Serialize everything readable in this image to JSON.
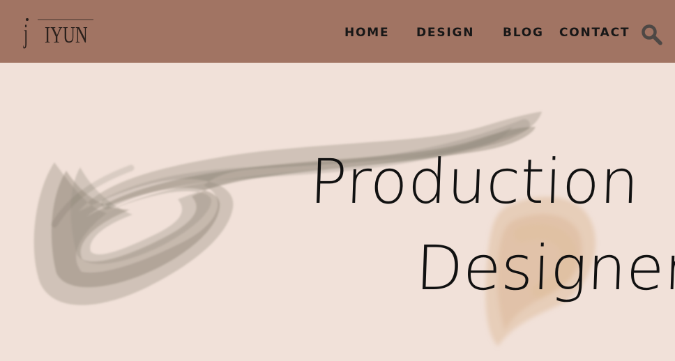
{
  "header": {
    "logo_initial": "j",
    "logo_name": "IYUN",
    "nav": {
      "home": "HOME",
      "design": "DESIGN",
      "blog": "BLOG",
      "contact": "CONTACT"
    },
    "search_icon": "search-icon"
  },
  "hero": {
    "line_1": "Production",
    "line_2": "Designer",
    "brush_icons": [
      "taupe-brushstroke",
      "tan-brushstroke"
    ]
  },
  "colors": {
    "header": "#a17463",
    "background": "#f1e1d9",
    "text": "#171717",
    "search_icon": "#4e4845",
    "brush_taupe": "#8f8879",
    "brush_tan": "#d8b38d"
  }
}
